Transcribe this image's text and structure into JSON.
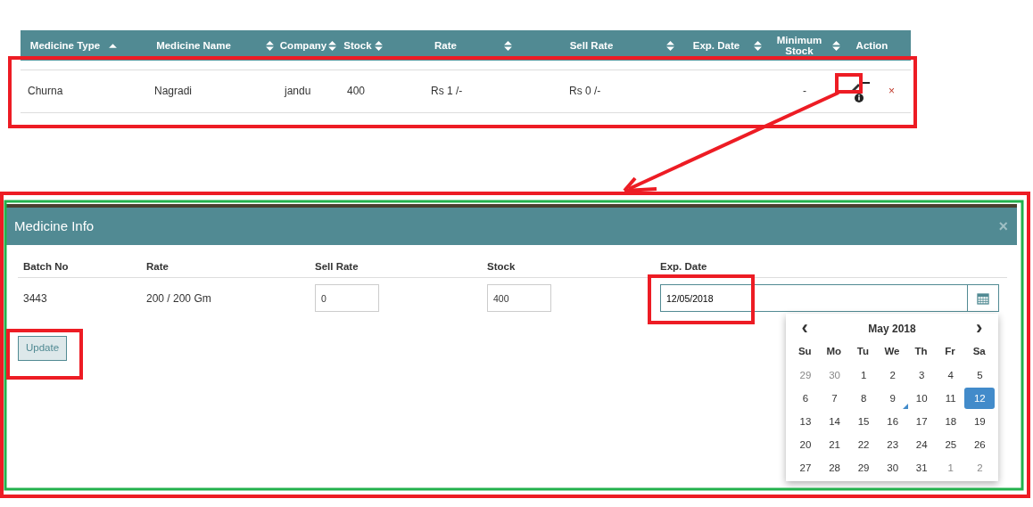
{
  "medicine_table": {
    "columns": [
      {
        "label": "Medicine Type",
        "sortable": true,
        "sorted": true
      },
      {
        "label": "Medicine Name",
        "sortable": true,
        "sorted": false
      },
      {
        "label": "Company",
        "sortable": true,
        "sorted": false
      },
      {
        "label": "Stock",
        "sortable": true,
        "sorted": false
      },
      {
        "label": "Rate",
        "sortable": true,
        "sorted": false
      },
      {
        "label": "Sell Rate",
        "sortable": true,
        "sorted": false
      },
      {
        "label": "Exp. Date",
        "sortable": true,
        "sorted": false
      },
      {
        "label": "Minimum Stock",
        "sortable": true,
        "sorted": false
      },
      {
        "label": "Action",
        "sortable": false
      }
    ],
    "rows": [
      {
        "cells": [
          "Churna",
          "Nagradi",
          "jandu",
          "400",
          "Rs 1 /-",
          "Rs 0 /-",
          "",
          "-"
        ],
        "delete": "×"
      }
    ]
  },
  "modal": {
    "title": "Medicine Info",
    "close": "×",
    "columns": [
      "Batch No",
      "Rate",
      "Sell Rate",
      "Stock",
      "Exp. Date"
    ],
    "row": {
      "batch_no": "3443",
      "rate": "200 / 200 Gm",
      "sell_rate": "0",
      "stock": "400",
      "exp_date": "12/05/2018"
    },
    "button": "Update",
    "datepicker": {
      "prev": "‹",
      "month": "May 2018",
      "next": "›",
      "weekdays": [
        "Su",
        "Mo",
        "Tu",
        "We",
        "Th",
        "Fr",
        "Sa"
      ],
      "weeks": [
        [
          {
            "day": "29",
            "muted": true,
            "selected": false
          },
          {
            "day": "30",
            "muted": true,
            "selected": false
          },
          {
            "day": "1",
            "muted": false,
            "selected": false
          },
          {
            "day": "2",
            "muted": false,
            "selected": false
          },
          {
            "day": "3",
            "muted": false,
            "selected": false
          },
          {
            "day": "4",
            "muted": false,
            "selected": false
          },
          {
            "day": "5",
            "muted": false,
            "selected": false
          }
        ],
        [
          {
            "day": "6",
            "muted": false,
            "selected": false
          },
          {
            "day": "7",
            "muted": false,
            "selected": false
          },
          {
            "day": "8",
            "muted": false,
            "selected": false
          },
          {
            "day": "9",
            "muted": false,
            "selected": false,
            "today": true
          },
          {
            "day": "10",
            "muted": false,
            "selected": false
          },
          {
            "day": "11",
            "muted": false,
            "selected": false
          },
          {
            "day": "12",
            "muted": false,
            "selected": true
          }
        ],
        [
          {
            "day": "13",
            "muted": false,
            "selected": false
          },
          {
            "day": "14",
            "muted": false,
            "selected": false
          },
          {
            "day": "15",
            "muted": false,
            "selected": false
          },
          {
            "day": "16",
            "muted": false,
            "selected": false
          },
          {
            "day": "17",
            "muted": false,
            "selected": false
          },
          {
            "day": "18",
            "muted": false,
            "selected": false
          },
          {
            "day": "19",
            "muted": false,
            "selected": false
          }
        ],
        [
          {
            "day": "20",
            "muted": false,
            "selected": false
          },
          {
            "day": "21",
            "muted": false,
            "selected": false
          },
          {
            "day": "22",
            "muted": false,
            "selected": false
          },
          {
            "day": "23",
            "muted": false,
            "selected": false
          },
          {
            "day": "24",
            "muted": false,
            "selected": false
          },
          {
            "day": "25",
            "muted": false,
            "selected": false
          },
          {
            "day": "26",
            "muted": false,
            "selected": false
          }
        ],
        [
          {
            "day": "27",
            "muted": false,
            "selected": false
          },
          {
            "day": "28",
            "muted": false,
            "selected": false
          },
          {
            "day": "29",
            "muted": false,
            "selected": false
          },
          {
            "day": "30",
            "muted": false,
            "selected": false
          },
          {
            "day": "31",
            "muted": false,
            "selected": false
          },
          {
            "day": "1",
            "muted": true,
            "selected": false
          },
          {
            "day": "2",
            "muted": true,
            "selected": false
          }
        ]
      ]
    }
  },
  "annotations": [
    {
      "kind": "box",
      "color": "#ed1c24"
    },
    {
      "kind": "box",
      "color": "#ed1c24"
    },
    {
      "kind": "arrow",
      "color": "#ed1c24"
    },
    {
      "kind": "box",
      "color": "#ed1c24"
    },
    {
      "kind": "box",
      "color": "#22b14c"
    },
    {
      "kind": "box",
      "color": "#ed1c24"
    },
    {
      "kind": "box",
      "color": "#ed1c24"
    }
  ]
}
